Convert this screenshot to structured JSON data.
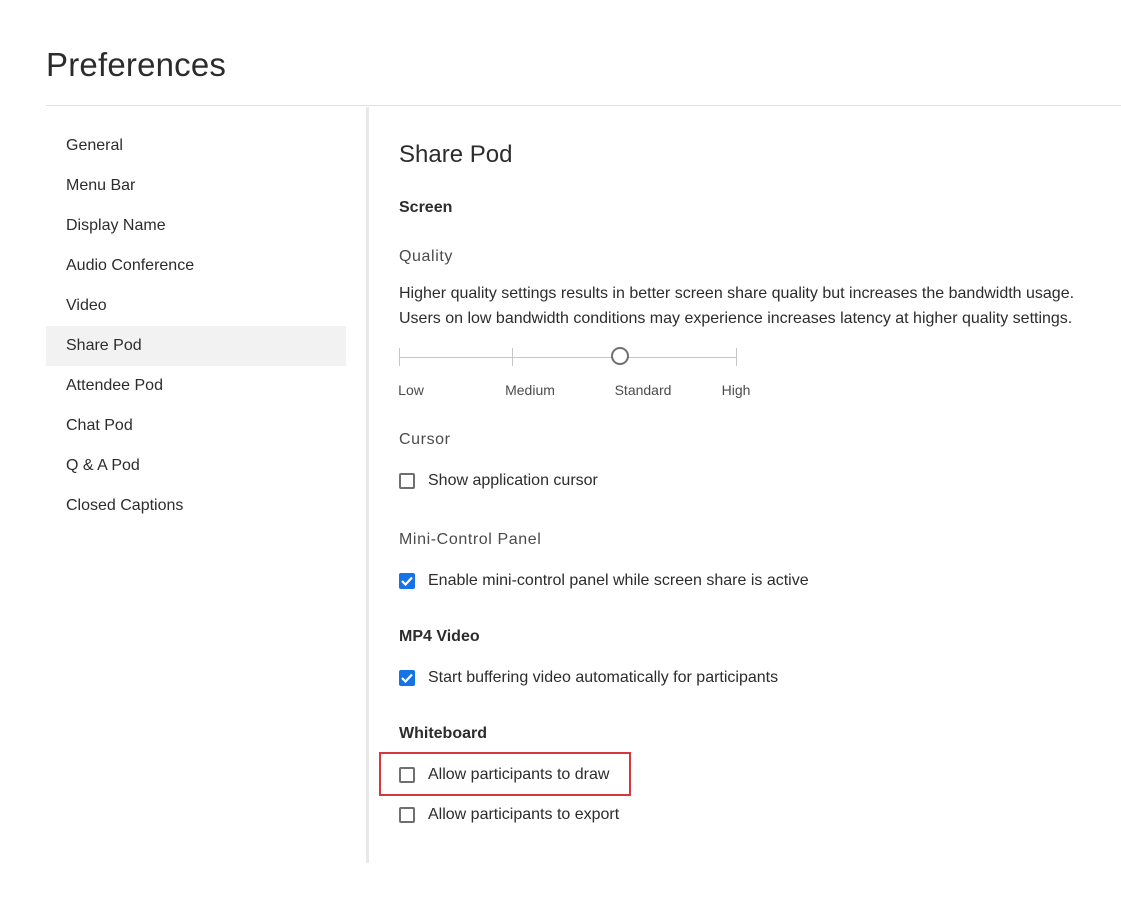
{
  "page": {
    "title": "Preferences"
  },
  "sidebar": {
    "items": [
      {
        "label": "General",
        "active": false
      },
      {
        "label": "Menu Bar",
        "active": false
      },
      {
        "label": "Display Name",
        "active": false
      },
      {
        "label": "Audio Conference",
        "active": false
      },
      {
        "label": "Video",
        "active": false
      },
      {
        "label": "Share Pod",
        "active": true
      },
      {
        "label": "Attendee Pod",
        "active": false
      },
      {
        "label": "Chat Pod",
        "active": false
      },
      {
        "label": "Q & A Pod",
        "active": false
      },
      {
        "label": "Closed Captions",
        "active": false
      }
    ]
  },
  "main": {
    "title": "Share Pod",
    "screen_heading": "Screen",
    "quality": {
      "heading": "Quality",
      "description": "Higher quality settings results in better screen share quality but increases the bandwidth usage. Users on low bandwidth conditions may experience increases latency at higher quality settings.",
      "levels": [
        "Low",
        "Medium",
        "Standard",
        "High"
      ],
      "selected": "Standard"
    },
    "cursor": {
      "heading": "Cursor",
      "show_cursor_label": "Show application cursor",
      "show_cursor_checked": false
    },
    "mini_control": {
      "heading": "Mini-Control Panel",
      "enable_label": "Enable mini-control panel while screen share is active",
      "enable_checked": true
    },
    "mp4": {
      "heading": "MP4 Video",
      "buffer_label": "Start buffering video automatically for participants",
      "buffer_checked": true
    },
    "whiteboard": {
      "heading": "Whiteboard",
      "draw_label": "Allow participants to draw",
      "draw_checked": false,
      "export_label": "Allow participants to export",
      "export_checked": false
    }
  },
  "colors": {
    "accent": "#1473e6",
    "highlight": "#d7373f",
    "active_nav_bg": "#f2f2f2"
  }
}
